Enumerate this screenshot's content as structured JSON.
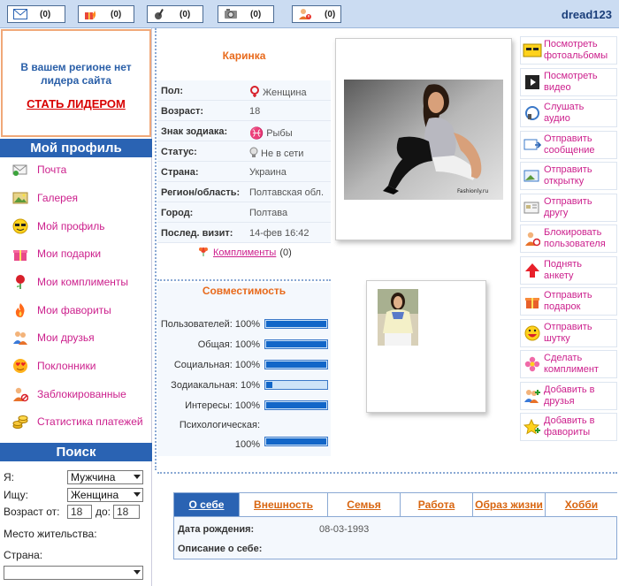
{
  "topbar": {
    "counters": [
      {
        "icon": "envelope-icon",
        "count": "(0)"
      },
      {
        "icon": "gift-fire-icon",
        "count": "(0)"
      },
      {
        "icon": "guitar-icon",
        "count": "(0)"
      },
      {
        "icon": "camera-icon",
        "count": "(0)"
      },
      {
        "icon": "users-alert-icon",
        "count": "(0)"
      }
    ],
    "username": "dread123"
  },
  "leader": {
    "text": "В вашем регионе нет лидера сайта",
    "cta": "СТАТЬ ЛИДЕРОМ"
  },
  "my_profile": {
    "title": "Мой профиль",
    "items": [
      {
        "label": "Почта",
        "icon": "mail-icon"
      },
      {
        "label": "Галерея",
        "icon": "gallery-icon"
      },
      {
        "label": "Мой профиль",
        "icon": "smiley-sunglasses-icon"
      },
      {
        "label": "Мои подарки",
        "icon": "gift-icon"
      },
      {
        "label": "Мои комплименты",
        "icon": "rose-icon"
      },
      {
        "label": "Мои фавориты",
        "icon": "fire-icon"
      },
      {
        "label": "Мои друзья",
        "icon": "friends-icon"
      },
      {
        "label": "Поклонники",
        "icon": "heart-eyes-icon"
      },
      {
        "label": "Заблокированные",
        "icon": "blocked-user-icon"
      },
      {
        "label": "Статистика платежей",
        "icon": "coins-icon"
      }
    ]
  },
  "search": {
    "title": "Поиск",
    "i_label": "Я:",
    "i_value": "Мужчина",
    "seek_label": "Ищу:",
    "seek_value": "Женщина",
    "age_label": "Возраст от:",
    "age_from": "18",
    "age_to_label": "до:",
    "age_to": "18",
    "residence_label": "Место жительства:",
    "country_label": "Страна:",
    "country_value": ""
  },
  "profile": {
    "name": "Каринка",
    "rows": [
      {
        "key": "Пол:",
        "value": "Женщина",
        "icon": "female-icon"
      },
      {
        "key": "Возраст:",
        "value": "18"
      },
      {
        "key": "Знак зодиака:",
        "value": "Рыбы",
        "icon": "pisces-icon"
      },
      {
        "key": "Статус:",
        "value": "Не в сети",
        "icon": "bulb-icon"
      },
      {
        "key": "Страна:",
        "value": "Украина"
      },
      {
        "key": "Регион/область:",
        "value": "Полтавская обл."
      },
      {
        "key": "Город:",
        "value": "Полтава"
      },
      {
        "key": "Послед. визит:",
        "value": "14-фев 16:42"
      }
    ],
    "compliments_label": "Комплименты",
    "compliments_count": "(0)"
  },
  "compat": {
    "title": "Совместимость",
    "rows": [
      {
        "label": "Пользователей:",
        "pct": "100%",
        "fraction": 1.0
      },
      {
        "label": "Общая:",
        "pct": "100%",
        "fraction": 1.0
      },
      {
        "label": "Социальная:",
        "pct": "100%",
        "fraction": 1.0
      },
      {
        "label": "Зодиакальная:",
        "pct": "10%",
        "fraction": 0.1
      },
      {
        "label": "Интересы:",
        "pct": "100%",
        "fraction": 1.0
      },
      {
        "label": "Психологическая:",
        "pct": "100%",
        "fraction": 1.0
      }
    ]
  },
  "photo_main_watermark": "Fashionly.ru",
  "actions": [
    {
      "label1": "Посмотреть",
      "label2": "фотоальбомы",
      "icon": "photo-album-icon"
    },
    {
      "label1": "Посмотреть",
      "label2": "видео",
      "icon": "video-icon"
    },
    {
      "label1": "Слушать",
      "label2": "аудио",
      "icon": "audio-icon"
    },
    {
      "label1": "Отправить",
      "label2": "сообщение",
      "icon": "send-message-icon"
    },
    {
      "label1": "Отправить",
      "label2": "открытку",
      "icon": "postcard-icon"
    },
    {
      "label1": "Отправить",
      "label2": "другу",
      "icon": "send-friend-icon"
    },
    {
      "label1": "Блокировать",
      "label2": "пользователя",
      "icon": "block-user-icon"
    },
    {
      "label1": "Поднять",
      "label2": "анкету",
      "icon": "up-arrow-icon"
    },
    {
      "label1": "Отправить",
      "label2": "подарок",
      "icon": "gift-icon"
    },
    {
      "label1": "Отправить",
      "label2": "шутку",
      "icon": "joke-icon"
    },
    {
      "label1": "Сделать",
      "label2": "комплимент",
      "icon": "flower-icon"
    },
    {
      "label1": "Добавить в",
      "label2": "друзья",
      "icon": "add-friend-icon"
    },
    {
      "label1": "Добавить в",
      "label2": "фавориты",
      "icon": "star-icon"
    }
  ],
  "tabs": {
    "items": [
      "О себе",
      "Внешность",
      "Семья",
      "Работа",
      "Образ жизни",
      "Хобби"
    ],
    "active": 0,
    "birth_label": "Дата рождения:",
    "birth_value": "08-03-1993",
    "about_label": "Описание о себе:"
  },
  "colors": {
    "accent_blue": "#2a63b3",
    "link_pink": "#cc1f8c",
    "orange": "#e86a1c",
    "cta_red": "#d80000"
  }
}
